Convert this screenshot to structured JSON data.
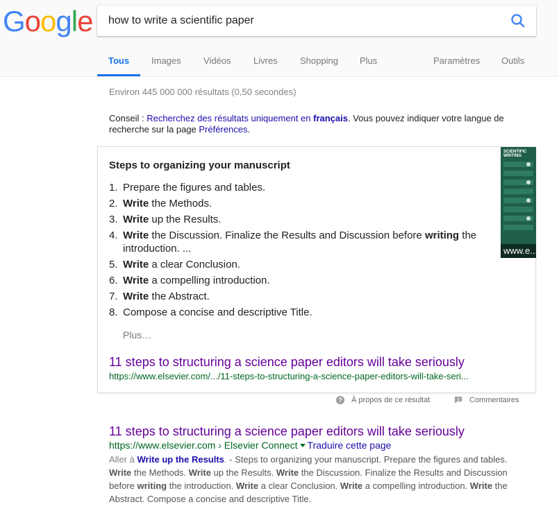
{
  "logo": {
    "letters": [
      "G",
      "o",
      "o",
      "g",
      "l",
      "e"
    ],
    "colors": [
      "#4285F4",
      "#EA4335",
      "#FBBC05",
      "#4285F4",
      "#34A853",
      "#EA4335"
    ]
  },
  "search": {
    "query": "how to write a scientific paper",
    "button_icon": "search-icon"
  },
  "tabs": [
    "Tous",
    "Images",
    "Vidéos",
    "Livres",
    "Shopping",
    "Plus",
    "Paramètres",
    "Outils"
  ],
  "stats": "Environ 445 000 000 résultats (0,50 secondes)",
  "tip": {
    "prefix": "Conseil : ",
    "link1": "Recherchez des résultats uniquement en ",
    "link1_bold": "français",
    "middle": ". Vous pouvez indiquer votre langue de recherche sur la page ",
    "link2": "Préférences",
    "suffix": "."
  },
  "featured": {
    "title": "Steps to organizing your manuscript",
    "steps": [
      {
        "num": "1.",
        "parts": [
          [
            "",
            "Prepare the figures and tables."
          ]
        ]
      },
      {
        "num": "2.",
        "parts": [
          [
            "b",
            "Write"
          ],
          [
            "",
            " the Methods."
          ]
        ]
      },
      {
        "num": "3.",
        "parts": [
          [
            "b",
            "Write"
          ],
          [
            "",
            " up the Results."
          ]
        ]
      },
      {
        "num": "4.",
        "parts": [
          [
            "b",
            "Write"
          ],
          [
            "",
            " the Discussion. Finalize the Results and Discussion before "
          ],
          [
            "b",
            "writing"
          ],
          [
            "",
            " the introduction. ..."
          ]
        ]
      },
      {
        "num": "5.",
        "parts": [
          [
            "b",
            "Write"
          ],
          [
            "",
            " a clear Conclusion."
          ]
        ]
      },
      {
        "num": "6.",
        "parts": [
          [
            "b",
            "Write"
          ],
          [
            "",
            " a compelling introduction."
          ]
        ]
      },
      {
        "num": "7.",
        "parts": [
          [
            "b",
            "Write"
          ],
          [
            "",
            " the Abstract."
          ]
        ]
      },
      {
        "num": "8.",
        "parts": [
          [
            "",
            "Compose a concise and descriptive Title."
          ]
        ]
      }
    ],
    "more": "Plus…",
    "result_title": "11 steps to structuring a science paper editors will take seriously",
    "result_url": "https://www.elsevier.com/.../11-steps-to-structuring-a-science-paper-editors-will-take-seri...",
    "thumb_heading": "SCIENTIFIC WRITING",
    "thumb_caption": "www.e..."
  },
  "feedback": {
    "about": "À propos de ce résultat",
    "comments": "Commentaires"
  },
  "result": {
    "title": "11 steps to structuring a science paper editors will take seriously",
    "url": "https://www.elsevier.com › Elsevier Connect",
    "translate": "Traduire cette page",
    "snippet": [
      [
        "jump",
        "Aller à "
      ],
      [
        "linkb",
        "Write up the Results"
      ],
      [
        "jump",
        "."
      ],
      [
        "",
        " - Steps to organizing your manuscript. Prepare the figures and tables. "
      ],
      [
        "b",
        "Write"
      ],
      [
        "",
        " the Methods. "
      ],
      [
        "b",
        "Write"
      ],
      [
        "",
        " up the Results. "
      ],
      [
        "b",
        "Write"
      ],
      [
        "",
        " the Discussion. Finalize the Results and Discussion before "
      ],
      [
        "b",
        "writing"
      ],
      [
        "",
        " the introduction. "
      ],
      [
        "b",
        "Write"
      ],
      [
        "",
        " a clear Conclusion. "
      ],
      [
        "b",
        "Write"
      ],
      [
        "",
        " a compelling introduction. "
      ],
      [
        "b",
        "Write"
      ],
      [
        "",
        " the Abstract. Compose a concise and descriptive Title."
      ]
    ]
  }
}
